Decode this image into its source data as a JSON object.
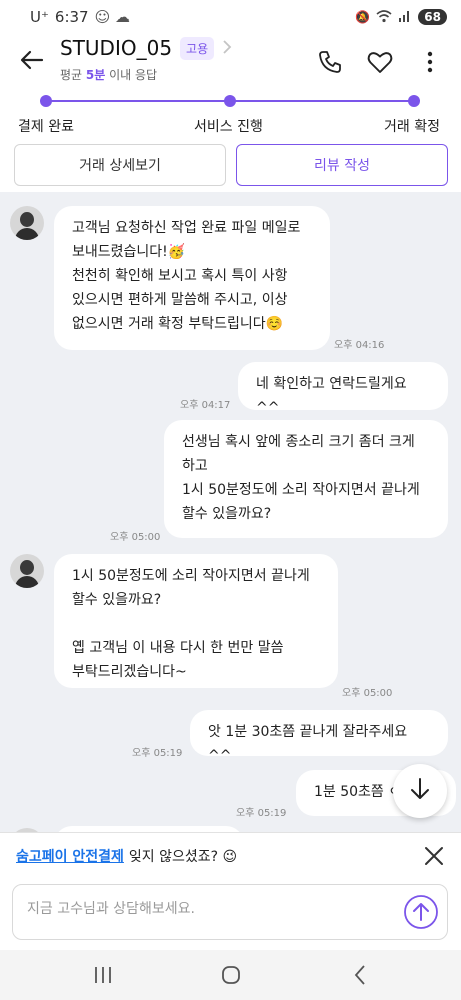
{
  "status_bar": {
    "carrier": "U⁺",
    "time": "6:37",
    "battery": "68"
  },
  "header": {
    "title": "STUDIO_05",
    "badge": "고용",
    "subtitle_prefix": "평균 ",
    "subtitle_highlight": "5분",
    "subtitle_suffix": " 이내 응답",
    "icons": [
      "back-arrow-icon",
      "phone-icon",
      "heart-icon",
      "more-vertical-icon"
    ]
  },
  "progress": {
    "steps": [
      "결제 완료",
      "서비스 진행",
      "거래 확정"
    ],
    "color": "#7b55ea"
  },
  "actions": {
    "details_label": "거래 상세보기",
    "review_label": "리뷰 작성"
  },
  "messages": [
    {
      "side": "left",
      "text": "고객님 요청하신 작업 완료 파일 메일로\n보내드렸습니다!🥳\n천천히 확인해 보시고 혹시 특이 사항\n있으시면 편하게 말씀해 주시고, 이상\n없으시면 거래 확정 부탁드립니다☺️",
      "time": "오후 04:16"
    },
    {
      "side": "right",
      "text": "네 확인하고 연락드릴게요 ^^",
      "time": "오후 04:17"
    },
    {
      "side": "right",
      "text": "선생님 혹시 앞에 종소리 크기 좀더 크게\n하고\n1시 50분정도에 소리 작아지면서 끝나게\n할수 있을까요?",
      "time": "오후 05:00"
    },
    {
      "side": "left",
      "text": "1시 50분정도에 소리 작아지면서 끝나게\n할수 있을까요?\n\n옙 고객님 이 내용 다시 한 번만 말씀\n부탁드리겠습니다~",
      "time": "오후 05:00"
    },
    {
      "side": "right",
      "text": "앗 1분 30초쯤 끝나게 잘라주세요 ^^",
      "time": "오후 05:19"
    },
    {
      "side": "right",
      "text": "1분 50초쯤 ㅇ",
      "time": "오후 05:19"
    }
  ],
  "notice": {
    "link": "숨고페이 안전결제",
    "text": "잊지 않으셨죠? 😉"
  },
  "input": {
    "placeholder": "지금 고수님과 상담해보세요."
  },
  "colors": {
    "accent": "#7b55ea",
    "chat_background": "#eef0f4",
    "link": "#1a73e8"
  }
}
